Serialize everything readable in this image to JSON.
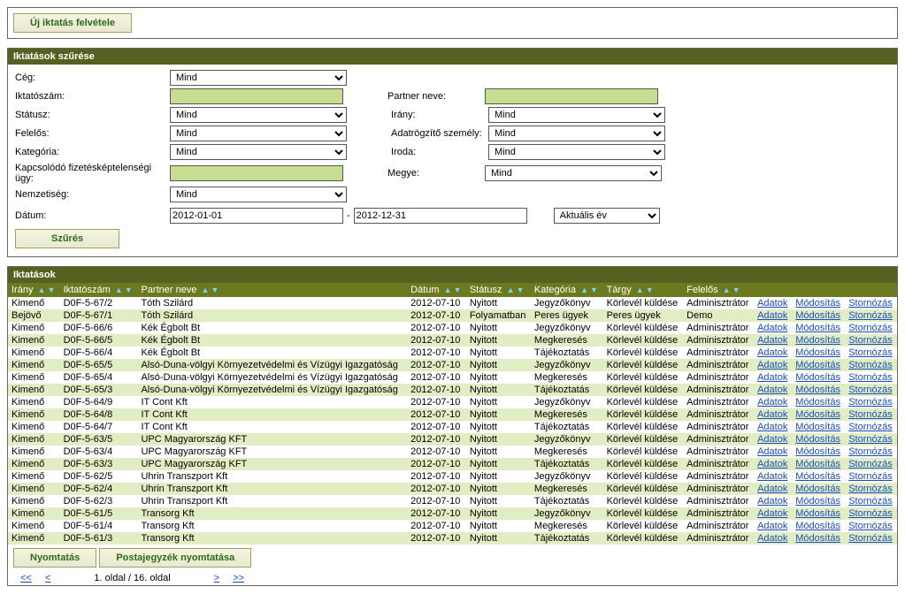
{
  "top_button": "Új iktatás felvétele",
  "filter": {
    "title": "Iktatások szűrése",
    "labels": {
      "ceg": "Cég:",
      "iktatoszam": "Iktatószám:",
      "statusz": "Státusz:",
      "felelos": "Felelős:",
      "kategoria": "Kategória:",
      "kapcsolodo": "Kapcsolódó fizetésképtelenségi ügy:",
      "nemzetiseg": "Nemzetiség:",
      "datum": "Dátum:",
      "partner": "Partner neve:",
      "irany": "Irány:",
      "adatrogzito": "Adatrögzítő személy:",
      "iroda": "Iroda:",
      "megye": "Megye:"
    },
    "values": {
      "ceg": "Mind",
      "iktatoszam": "",
      "statusz": "Mind",
      "felelos": "Mind",
      "kategoria": "Mind",
      "kapcsolodo": "",
      "nemzetiseg": "Mind",
      "date_from": "2012-01-01",
      "date_to": "2012-12-31",
      "date_preset": "Aktuális év",
      "partner": "",
      "irany": "Mind",
      "adatrogzito": "Mind",
      "iroda": "Mind",
      "megye": "Mind"
    },
    "submit": "Szűrés"
  },
  "list": {
    "title": "Iktatások",
    "headers": [
      "Irány",
      "Iktatószám",
      "Partner neve",
      "Dátum",
      "Státusz",
      "Kategória",
      "Tárgy",
      "Felelős",
      "",
      "",
      ""
    ],
    "action_labels": {
      "adatok": "Adatok",
      "modositas": "Módosítás",
      "stornozas": "Stornózás"
    },
    "rows": [
      {
        "irany": "Kimenő",
        "ik": "D0F-5-67/2",
        "partner": "Tóth Szilárd",
        "datum": "2012-07-10",
        "statusz": "Nyitott",
        "kat": "Jegyzőkönyv",
        "targy": "Körlevél küldése",
        "felelos": "Adminisztrátor"
      },
      {
        "irany": "Bejövő",
        "ik": "D0F-5-67/1",
        "partner": "Tóth Szilárd",
        "datum": "2012-07-10",
        "statusz": "Folyamatban",
        "kat": "Peres ügyek",
        "targy": "Peres ügyek",
        "felelos": "Demo"
      },
      {
        "irany": "Kimenő",
        "ik": "D0F-5-66/6",
        "partner": "Kék Égbolt Bt",
        "datum": "2012-07-10",
        "statusz": "Nyitott",
        "kat": "Jegyzőkönyv",
        "targy": "Körlevél küldése",
        "felelos": "Adminisztrátor"
      },
      {
        "irany": "Kimenő",
        "ik": "D0F-5-66/5",
        "partner": "Kék Égbolt Bt",
        "datum": "2012-07-10",
        "statusz": "Nyitott",
        "kat": "Megkeresés",
        "targy": "Körlevél küldése",
        "felelos": "Adminisztrátor"
      },
      {
        "irany": "Kimenő",
        "ik": "D0F-5-66/4",
        "partner": "Kék Égbolt Bt",
        "datum": "2012-07-10",
        "statusz": "Nyitott",
        "kat": "Tájékoztatás",
        "targy": "Körlevél küldése",
        "felelos": "Adminisztrátor"
      },
      {
        "irany": "Kimenő",
        "ik": "D0F-5-65/5",
        "partner": "Alsó-Duna-völgyi Környezetvédelmi és Vízügyi Igazgatóság",
        "datum": "2012-07-10",
        "statusz": "Nyitott",
        "kat": "Jegyzőkönyv",
        "targy": "Körlevél küldése",
        "felelos": "Adminisztrátor"
      },
      {
        "irany": "Kimenő",
        "ik": "D0F-5-65/4",
        "partner": "Alsó-Duna-völgyi Környezetvédelmi és Vízügyi Igazgatóság",
        "datum": "2012-07-10",
        "statusz": "Nyitott",
        "kat": "Megkeresés",
        "targy": "Körlevél küldése",
        "felelos": "Adminisztrátor"
      },
      {
        "irany": "Kimenő",
        "ik": "D0F-5-65/3",
        "partner": "Alsó-Duna-völgyi Környezetvédelmi és Vízügyi Igazgatóság",
        "datum": "2012-07-10",
        "statusz": "Nyitott",
        "kat": "Tájékoztatás",
        "targy": "Körlevél küldése",
        "felelos": "Adminisztrátor"
      },
      {
        "irany": "Kimenő",
        "ik": "D0F-5-64/9",
        "partner": "IT Cont Kft",
        "datum": "2012-07-10",
        "statusz": "Nyitott",
        "kat": "Jegyzőkönyv",
        "targy": "Körlevél küldése",
        "felelos": "Adminisztrátor"
      },
      {
        "irany": "Kimenő",
        "ik": "D0F-5-64/8",
        "partner": "IT Cont Kft",
        "datum": "2012-07-10",
        "statusz": "Nyitott",
        "kat": "Megkeresés",
        "targy": "Körlevél küldése",
        "felelos": "Adminisztrátor"
      },
      {
        "irany": "Kimenő",
        "ik": "D0F-5-64/7",
        "partner": "IT Cont Kft",
        "datum": "2012-07-10",
        "statusz": "Nyitott",
        "kat": "Tájékoztatás",
        "targy": "Körlevél küldése",
        "felelos": "Adminisztrátor"
      },
      {
        "irany": "Kimenő",
        "ik": "D0F-5-63/5",
        "partner": "UPC Magyarország KFT",
        "datum": "2012-07-10",
        "statusz": "Nyitott",
        "kat": "Jegyzőkönyv",
        "targy": "Körlevél küldése",
        "felelos": "Adminisztrátor"
      },
      {
        "irany": "Kimenő",
        "ik": "D0F-5-63/4",
        "partner": "UPC Magyarország KFT",
        "datum": "2012-07-10",
        "statusz": "Nyitott",
        "kat": "Megkeresés",
        "targy": "Körlevél küldése",
        "felelos": "Adminisztrátor"
      },
      {
        "irany": "Kimenő",
        "ik": "D0F-5-63/3",
        "partner": "UPC Magyarország KFT",
        "datum": "2012-07-10",
        "statusz": "Nyitott",
        "kat": "Tájékoztatás",
        "targy": "Körlevél küldése",
        "felelos": "Adminisztrátor"
      },
      {
        "irany": "Kimenő",
        "ik": "D0F-5-62/5",
        "partner": "Uhrin Transzport Kft",
        "datum": "2012-07-10",
        "statusz": "Nyitott",
        "kat": "Jegyzőkönyv",
        "targy": "Körlevél küldése",
        "felelos": "Adminisztrátor"
      },
      {
        "irany": "Kimenő",
        "ik": "D0F-5-62/4",
        "partner": "Uhrin Transzport Kft",
        "datum": "2012-07-10",
        "statusz": "Nyitott",
        "kat": "Megkeresés",
        "targy": "Körlevél küldése",
        "felelos": "Adminisztrátor"
      },
      {
        "irany": "Kimenő",
        "ik": "D0F-5-62/3",
        "partner": "Uhrin Transzport Kft",
        "datum": "2012-07-10",
        "statusz": "Nyitott",
        "kat": "Tájékoztatás",
        "targy": "Körlevél küldése",
        "felelos": "Adminisztrátor"
      },
      {
        "irany": "Kimenő",
        "ik": "D0F-5-61/5",
        "partner": "Transorg Kft",
        "datum": "2012-07-10",
        "statusz": "Nyitott",
        "kat": "Jegyzőkönyv",
        "targy": "Körlevél küldése",
        "felelos": "Adminisztrátor"
      },
      {
        "irany": "Kimenő",
        "ik": "D0F-5-61/4",
        "partner": "Transorg Kft",
        "datum": "2012-07-10",
        "statusz": "Nyitott",
        "kat": "Megkeresés",
        "targy": "Körlevél küldése",
        "felelos": "Adminisztrátor"
      },
      {
        "irany": "Kimenő",
        "ik": "D0F-5-61/3",
        "partner": "Transorg Kft",
        "datum": "2012-07-10",
        "statusz": "Nyitott",
        "kat": "Tájékoztatás",
        "targy": "Körlevél küldése",
        "felelos": "Adminisztrátor"
      }
    ],
    "footer_buttons": {
      "print": "Nyomtatás",
      "postlist": "Postajegyzék nyomtatása"
    },
    "pager": {
      "first": "<<",
      "prev": "<",
      "text": "1. oldal / 16. oldal",
      "next": ">",
      "last": ">>"
    }
  }
}
